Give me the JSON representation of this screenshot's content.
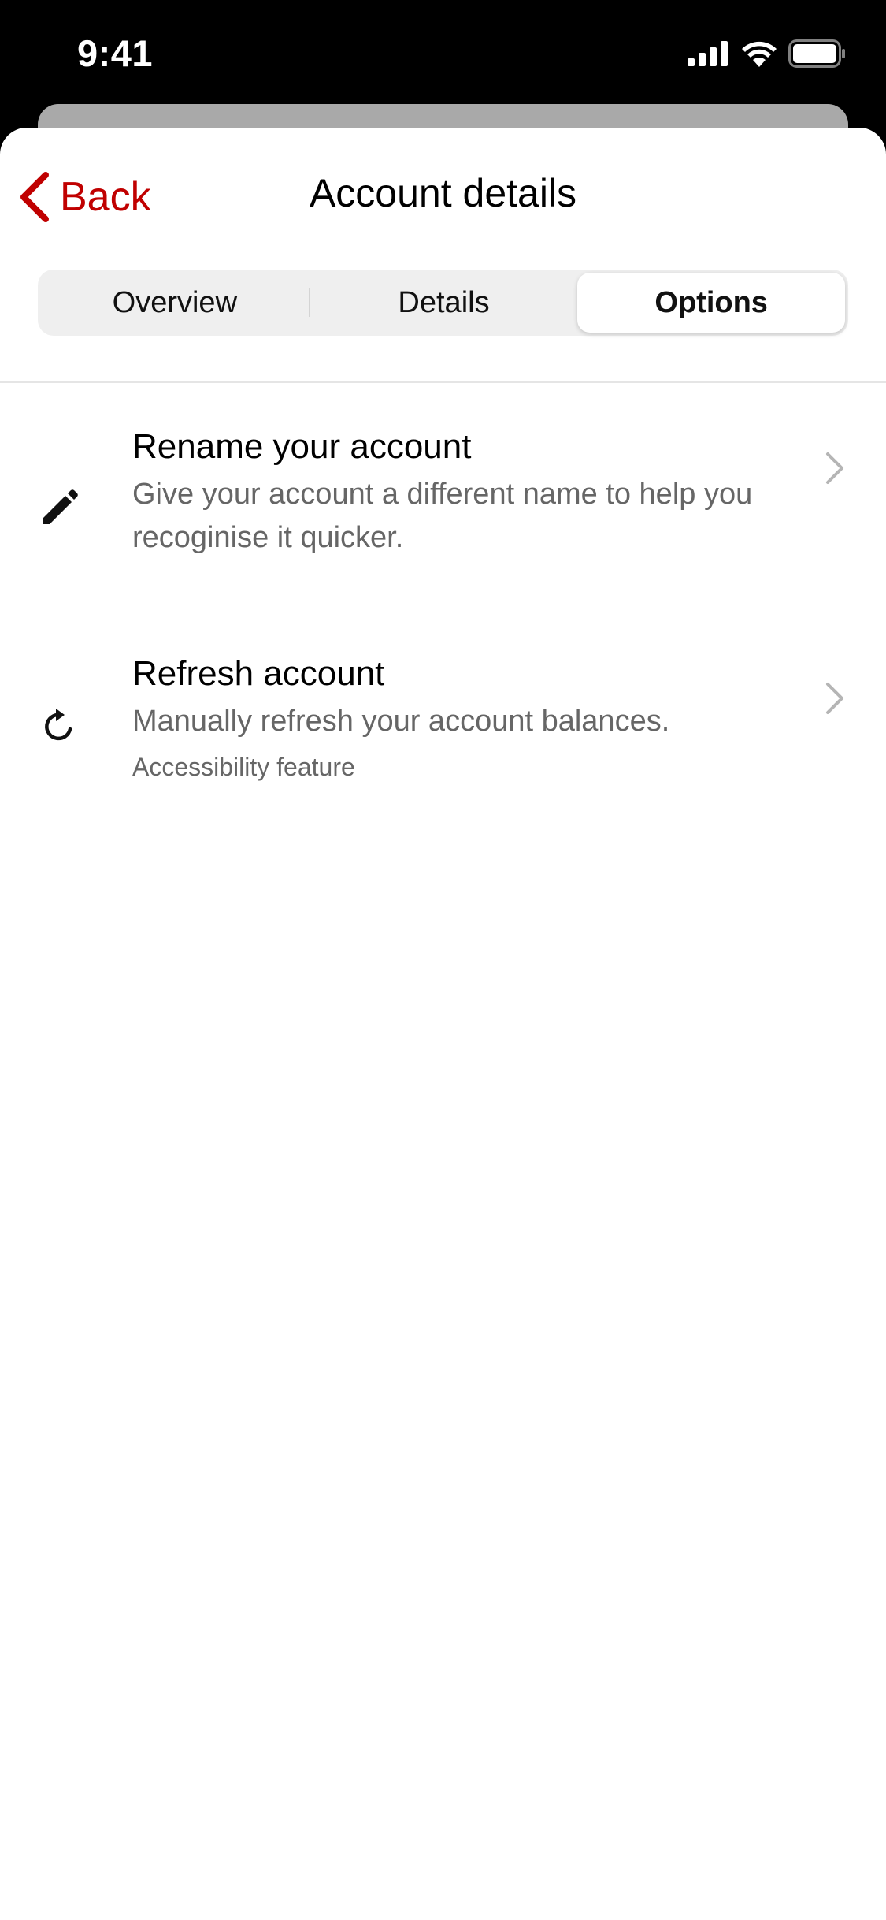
{
  "status_bar": {
    "time": "9:41"
  },
  "nav": {
    "back_label": "Back",
    "title": "Account details"
  },
  "tabs": [
    {
      "label": "Overview",
      "active": false
    },
    {
      "label": "Details",
      "active": false
    },
    {
      "label": "Options",
      "active": true
    }
  ],
  "options": [
    {
      "title": "Rename your account",
      "description": "Give your account a different name to help you recoginise it quicker.",
      "icon": "pencil-icon"
    },
    {
      "title": "Refresh account",
      "description": "Manually refresh your account balances.",
      "note": "Accessibility feature",
      "icon": "refresh-icon"
    }
  ],
  "colors": {
    "accent": "#c00000",
    "secondary_text": "#666666",
    "segment_bg": "#efefef"
  }
}
